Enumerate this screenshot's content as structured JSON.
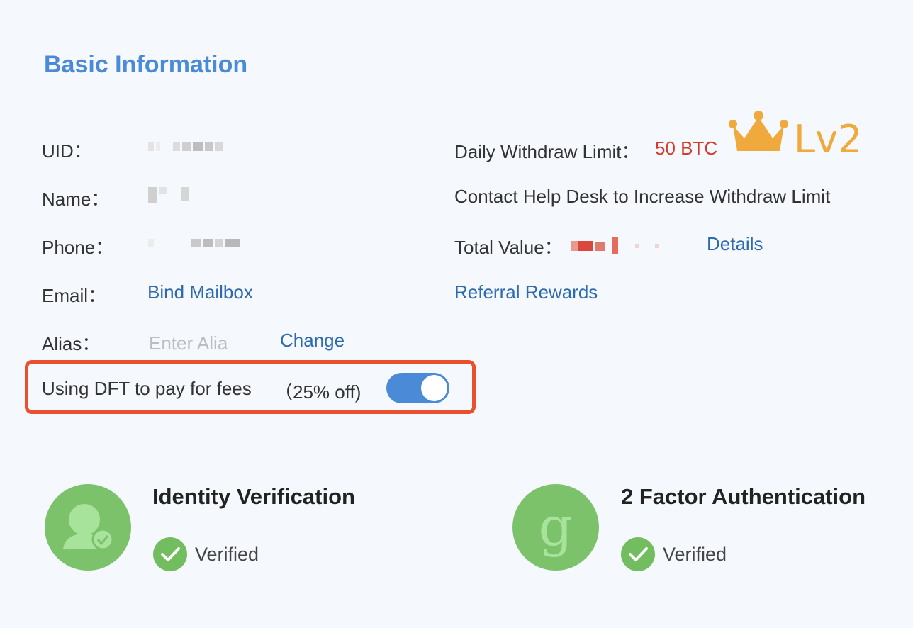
{
  "section": {
    "title": "Basic Information"
  },
  "left": {
    "uid_label": "UID：",
    "name_label": "Name：",
    "phone_label": "Phone：",
    "email_label": "Email：",
    "email_link": "Bind Mailbox",
    "alias_label": "Alias：",
    "alias_placeholder": "Enter Alia",
    "alias_change": "Change"
  },
  "right": {
    "withdraw_label": "Daily Withdraw Limit：",
    "withdraw_value": "50 BTC",
    "level": "Lv2",
    "increase_text": "Contact Help Desk to Increase Withdraw Limit",
    "total_value_label": "Total Value：",
    "details_link": "Details",
    "referral_link": "Referral Rewards"
  },
  "fees": {
    "label": "Using DFT to pay for fees",
    "discount": "（25% off)",
    "toggle_on": true
  },
  "cards": {
    "identity": {
      "title": "Identity Verification",
      "status": "Verified"
    },
    "twofa": {
      "title": "2 Factor Authentication",
      "status": "Verified"
    }
  },
  "colors": {
    "accent": "#4a8ad6",
    "link": "#2e6ab0",
    "highlight": "#e9502e",
    "success": "#7cc26a",
    "level": "#f0a93c",
    "value_red": "#d43a2a"
  }
}
